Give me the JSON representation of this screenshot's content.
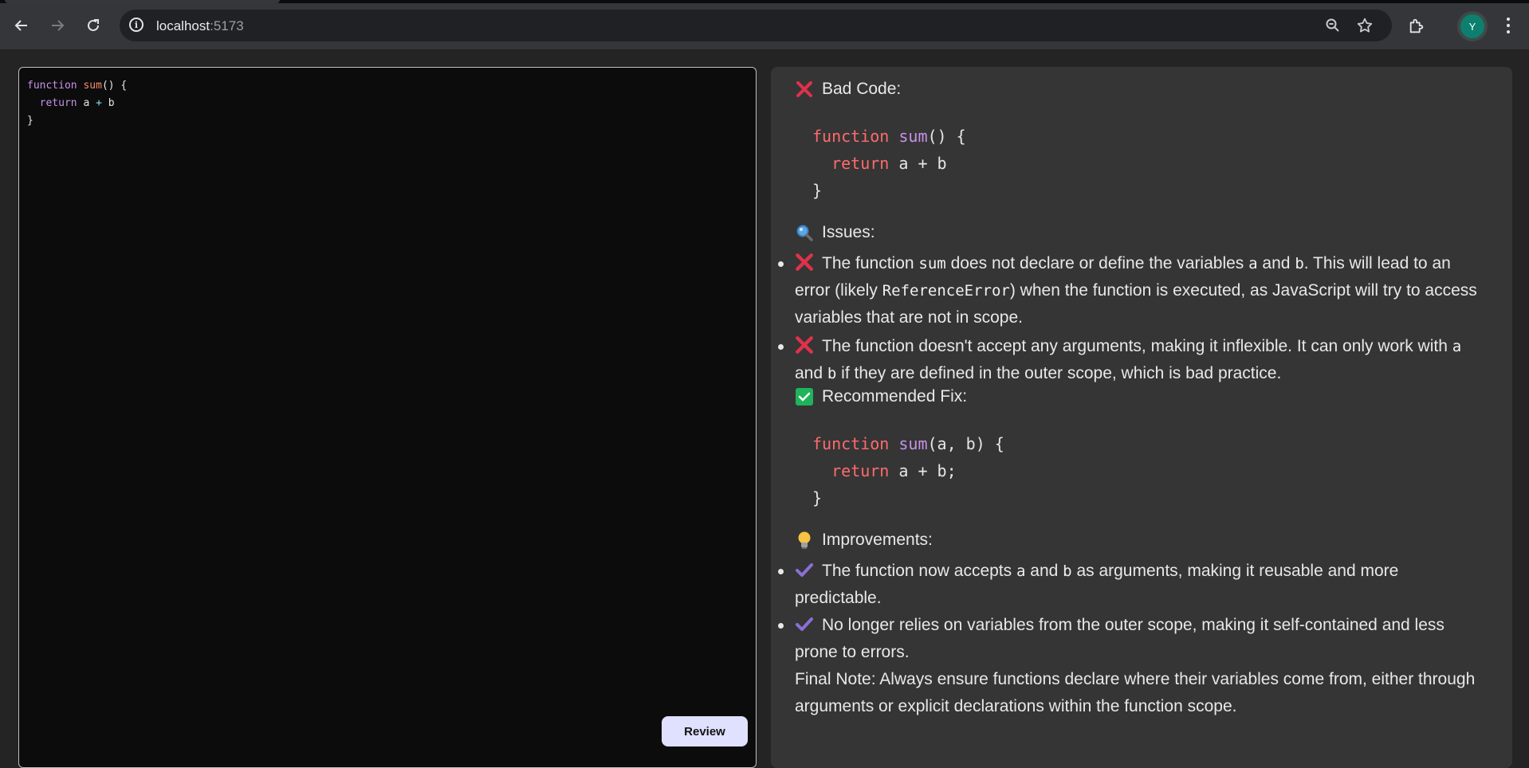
{
  "browser": {
    "url_host": "localhost",
    "url_port": ":5173",
    "profile_initial": "Y"
  },
  "editor": {
    "code_lines": [
      [
        {
          "t": "function ",
          "c": "kw-purple"
        },
        {
          "t": "sum",
          "c": "kw-orange"
        },
        {
          "t": "() {",
          "c": ""
        }
      ],
      [
        {
          "t": "  ",
          "c": ""
        },
        {
          "t": "return",
          "c": "kw-purple"
        },
        {
          "t": " a ",
          "c": ""
        },
        {
          "t": "+",
          "c": "op"
        },
        {
          "t": " b",
          "c": ""
        }
      ],
      [
        {
          "t": "}",
          "c": ""
        }
      ]
    ],
    "review_button_label": "Review"
  },
  "review": {
    "bad_code_title": "Bad Code:",
    "bad_code_lines": [
      [
        {
          "t": "function ",
          "c": "c-kw"
        },
        {
          "t": "sum",
          "c": "c-fn"
        },
        {
          "t": "() {",
          "c": ""
        }
      ],
      [
        {
          "t": "  ",
          "c": ""
        },
        {
          "t": "return",
          "c": "c-kw"
        },
        {
          "t": " a + b",
          "c": ""
        }
      ],
      [
        {
          "t": "}",
          "c": ""
        }
      ]
    ],
    "issues_title": "Issues:",
    "issues": [
      [
        {
          "t": "The function "
        },
        {
          "t": "sum",
          "code": true
        },
        {
          "t": " does not declare or define the variables "
        },
        {
          "t": "a",
          "code": true
        },
        {
          "t": " and "
        },
        {
          "t": "b",
          "code": true
        },
        {
          "t": ". This will lead to an error (likely "
        },
        {
          "t": "ReferenceError",
          "code": true
        },
        {
          "t": ") when the function is executed, as JavaScript will try to access variables that are not in scope."
        }
      ],
      [
        {
          "t": "The function doesn't accept any arguments, making it inflexible. It can only work with "
        },
        {
          "t": "a",
          "code": true
        },
        {
          "t": " and "
        },
        {
          "t": "b",
          "code": true
        },
        {
          "t": " if they are defined in the outer scope, which is bad practice."
        }
      ]
    ],
    "fix_title": "Recommended Fix:",
    "fix_code_lines": [
      [
        {
          "t": "function ",
          "c": "c-kw"
        },
        {
          "t": "sum",
          "c": "c-fn"
        },
        {
          "t": "(a, b) {",
          "c": ""
        }
      ],
      [
        {
          "t": "  ",
          "c": ""
        },
        {
          "t": "return",
          "c": "c-kw"
        },
        {
          "t": " a + b;",
          "c": ""
        }
      ],
      [
        {
          "t": "}",
          "c": ""
        }
      ]
    ],
    "improvements_title": "Improvements:",
    "improvements": [
      [
        {
          "t": "The function now accepts "
        },
        {
          "t": "a",
          "code": true
        },
        {
          "t": " and "
        },
        {
          "t": "b",
          "code": true
        },
        {
          "t": " as arguments, making it reusable and more predictable."
        }
      ],
      [
        {
          "t": "No longer relies on variables from the outer scope, making it self-contained and less prone to errors."
        }
      ]
    ],
    "final_note": "Final Note: Always ensure functions declare where their variables come from, either through arguments or explicit declarations within the function scope."
  },
  "colors": {
    "cross": "#e0314b",
    "check_box": "#1fb35b",
    "check_mark": "#8a6fd6"
  }
}
